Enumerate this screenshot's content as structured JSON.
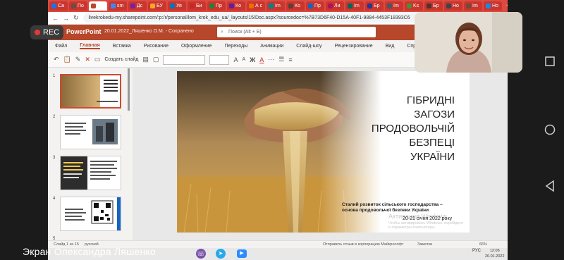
{
  "recording": {
    "label": "REC"
  },
  "caption": "Экран Олександра Ляшенко",
  "browser": {
    "tabs": [
      {
        "label": "Са",
        "color": "#1a73e8"
      },
      {
        "label": "По",
        "color": "#6d4c41"
      },
      {
        "label": "",
        "color": "#b7472a",
        "active": true
      },
      {
        "label": "sm",
        "color": "#4285f4"
      },
      {
        "label": "Дс",
        "color": "#7b1fa2"
      },
      {
        "label": "БУ",
        "color": "#f9a825"
      },
      {
        "label": "Уя",
        "color": "#0277bd"
      },
      {
        "label": "Би",
        "color": "#c62828"
      },
      {
        "label": "Пр",
        "color": "#2e7d32"
      },
      {
        "label": "Ко",
        "color": "#6a1b9a"
      },
      {
        "label": "А с",
        "color": "#ef6c00"
      },
      {
        "label": "Im",
        "color": "#00838f"
      },
      {
        "label": "Ко",
        "color": "#5d4037"
      },
      {
        "label": "Пр",
        "color": "#1565c0"
      },
      {
        "label": "Ли",
        "color": "#ad1457"
      },
      {
        "label": "Im",
        "color": "#00695c"
      },
      {
        "label": "Бр",
        "color": "#283593"
      },
      {
        "label": "Im",
        "color": "#455a64"
      },
      {
        "label": "Ks",
        "color": "#558b2f"
      },
      {
        "label": "Бр",
        "color": "#4e342e"
      },
      {
        "label": "Ho",
        "color": "#37474f"
      },
      {
        "label": "Im",
        "color": "#6d4c41"
      },
      {
        "label": "Ho",
        "color": "#1e88e5"
      }
    ],
    "url": "livekrokedu-my.sharepoint.com/:p:/r/personal/lom_krok_edu_ua/_layouts/15/Doc.aspx?sourcedoc=%7B73D6F40-D15A-40F1-9884-4453F18393C6"
  },
  "ppt": {
    "app_name": "PowerPoint",
    "doc_title": "20.01.2022_Ляшенко О.М. - Сохранено",
    "search_placeholder": "Поиск (Alt + Б)",
    "menu": [
      "Файл",
      "Главная",
      "Вставка",
      "Рисование",
      "Оформление",
      "Переходы",
      "Анимации",
      "Слайд-шоу",
      "Рецензирование",
      "Вид",
      "Справка"
    ],
    "active_menu": "Главная",
    "toolbar": {
      "new_slide": "Создать слайд",
      "font_a1": "A",
      "font_a2": "A",
      "bold": "Ж",
      "font_color": "A"
    },
    "thumb_numbers": [
      "1",
      "2",
      "3",
      "4",
      "5"
    ],
    "slide": {
      "title_lines": [
        "ГІБРИДНІ",
        "ЗАГОЗИ",
        "ПРОДОВОЛЬЧІЙ",
        "БЕЗПЕЦІ",
        "УКРАЇНИ"
      ],
      "subtitle": "Сталий розвиток сільського господарства – основа продовольчої безпеки України",
      "date": "20-21 січня 2022 року",
      "activation": "Активация Windows",
      "activation_sub": "Чтобы активировать Windows, перейдите в параметры компьютера."
    },
    "status": {
      "left": "Слайд 1 из 15",
      "lang": "русский",
      "center": "Отправить отзыв в корпорацию Майкрософт",
      "notes": "Заметки",
      "zoom": "66%"
    }
  },
  "tray": {
    "lang": "РУС",
    "time": "12:06",
    "date": "20.01.2022"
  }
}
